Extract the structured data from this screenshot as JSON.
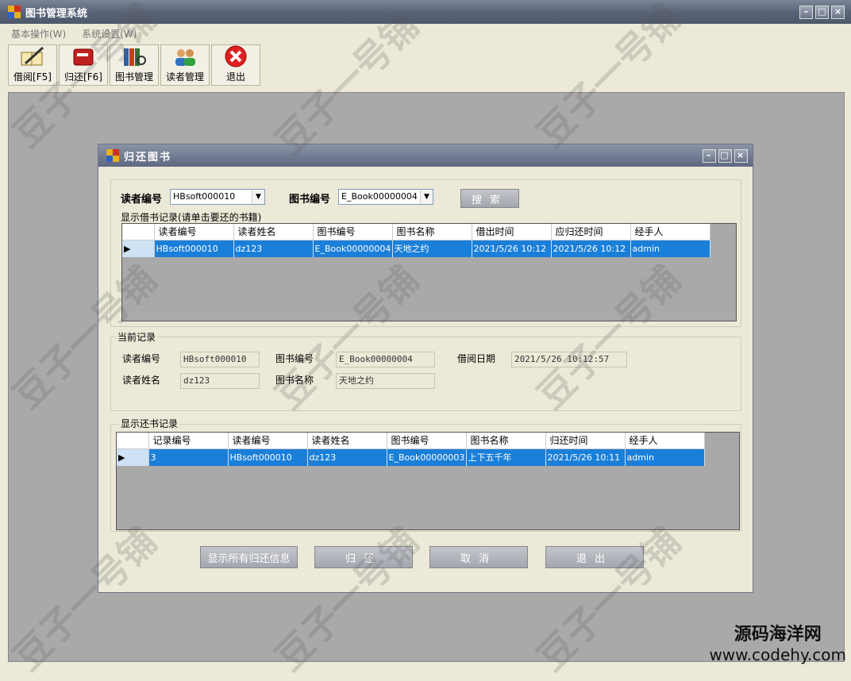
{
  "app": {
    "title": "图书管理系统"
  },
  "menu": {
    "items": [
      "基本操作(W)",
      "系统设置(W)"
    ]
  },
  "toolbar": {
    "items": [
      {
        "label": "借阅[F5]",
        "icon": "book-pen-icon"
      },
      {
        "label": "归还[F6]",
        "icon": "book-return-icon"
      },
      {
        "label": "图书管理",
        "icon": "books-icon"
      },
      {
        "label": "读者管理",
        "icon": "users-icon"
      },
      {
        "label": "退出",
        "icon": "exit-icon"
      }
    ]
  },
  "dialog": {
    "title": "归还图书",
    "search": {
      "reader_label": "读者编号",
      "reader_value": "HBsoft000010",
      "book_label": "图书编号",
      "book_value": "E_Book00000004",
      "search_button": "搜索"
    },
    "borrow": {
      "caption": "显示借书记录(请单击要还的书籍)",
      "columns": [
        "读者编号",
        "读者姓名",
        "图书编号",
        "图书名称",
        "借出时间",
        "应归还时间",
        "经手人"
      ],
      "rows": [
        [
          "HBsoft000010",
          "dz123",
          "E_Book00000004",
          "天地之约",
          "2021/5/26 10:12",
          "2021/5/26 10:12",
          "admin"
        ]
      ]
    },
    "current": {
      "caption": "当前记录",
      "reader_id_label": "读者编号",
      "reader_id": "HBsoft000010",
      "book_id_label": "图书编号",
      "book_id": "E_Book00000004",
      "date_label": "借阅日期",
      "date": "2021/5/26 10:12:57",
      "reader_name_label": "读者姓名",
      "reader_name": "dz123",
      "book_name_label": "图书名称",
      "book_name": "天地之约"
    },
    "returns": {
      "caption": "显示还书记录",
      "columns": [
        "记录编号",
        "读者编号",
        "读者姓名",
        "图书编号",
        "图书名称",
        "归还时间",
        "经手人"
      ],
      "rows": [
        [
          "3",
          "HBsoft000010",
          "dz123",
          "E_Book00000003",
          "上下五千年",
          "2021/5/26 10:11",
          "admin"
        ]
      ]
    },
    "buttons": {
      "show_all": "显示所有归还信息",
      "return": "归还",
      "cancel": "取消",
      "exit": "退出"
    }
  },
  "watermark": "豆子一号铺",
  "brand": {
    "cn": "源码海洋网",
    "en": "www.codehy.com"
  }
}
